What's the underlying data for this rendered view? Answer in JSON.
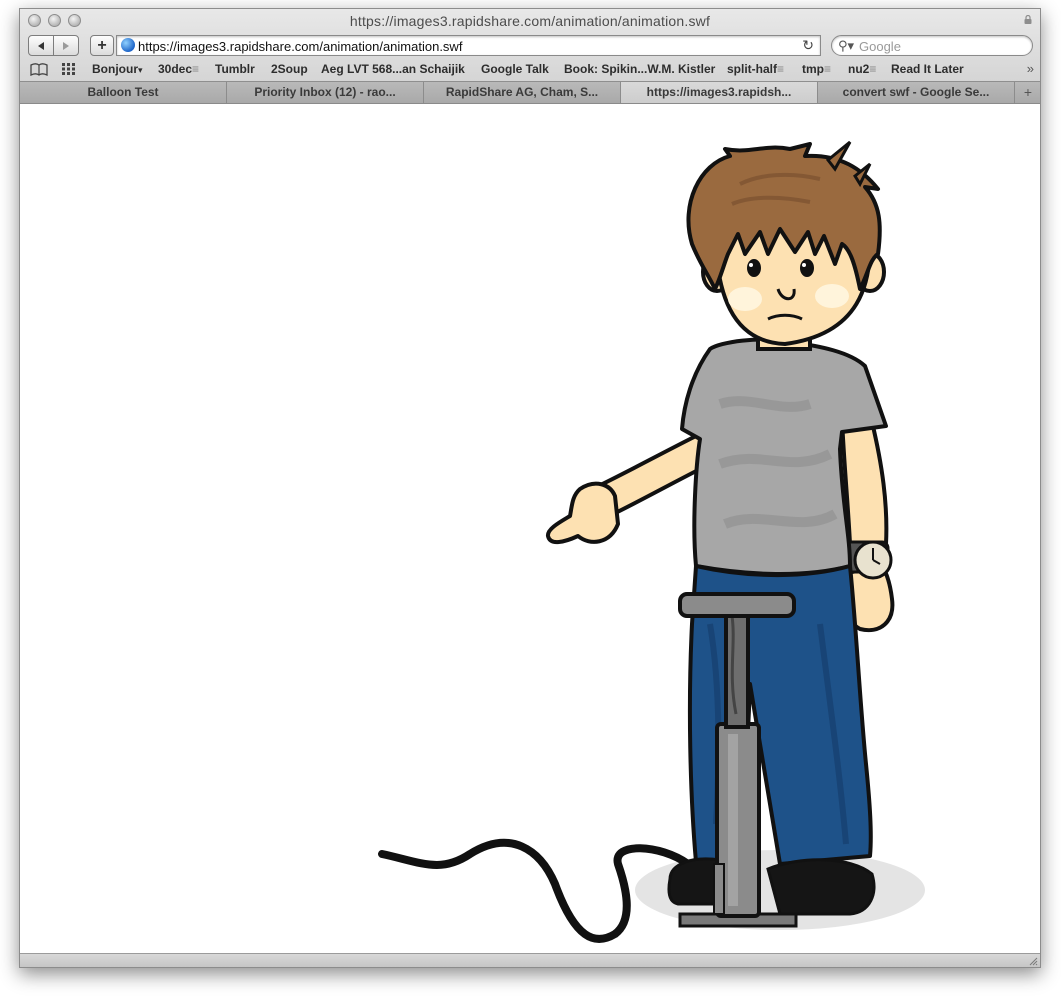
{
  "window": {
    "title": "https://images3.rapidshare.com/animation/animation.swf"
  },
  "navbar": {
    "back_icon": "back-arrow-icon",
    "forward_icon": "forward-arrow-icon",
    "add_bookmark_label": "+",
    "url": "https://images3.rapidshare.com/animation/animation.swf",
    "reload_icon": "reload-icon",
    "search_placeholder": "Google"
  },
  "bookmarks": [
    {
      "label": "Bonjour",
      "menu": true
    },
    {
      "label": "30dec",
      "menu": true
    },
    {
      "label": "Tumblr",
      "menu": false
    },
    {
      "label": "2Soup",
      "menu": false
    },
    {
      "label": "Aeg LVT 568...an Schaijik",
      "menu": false
    },
    {
      "label": "Google Talk",
      "menu": false
    },
    {
      "label": "Book: Spikin...W.M. Kistler",
      "menu": false
    },
    {
      "label": "split-half",
      "menu": true
    },
    {
      "label": "tmp",
      "menu": true
    },
    {
      "label": "nu2",
      "menu": true
    },
    {
      "label": "Read It Later",
      "menu": false
    }
  ],
  "tabs": [
    {
      "label": "Balloon Test",
      "active": false
    },
    {
      "label": "Priority Inbox (12) - rao...",
      "active": false
    },
    {
      "label": "RapidShare AG, Cham, S...",
      "active": false
    },
    {
      "label": "https://images3.rapidsh...",
      "active": true
    },
    {
      "label": "convert swf - Google Se...",
      "active": false
    }
  ],
  "content": {
    "illustration": "boy-with-bicycle-pump-pointing"
  },
  "colors": {
    "hair": "#9a6a3f",
    "shirt": "#a7a7a7",
    "jeans": "#1e5289",
    "skin": "#fde1b2",
    "pump": "#8b8b8b"
  }
}
